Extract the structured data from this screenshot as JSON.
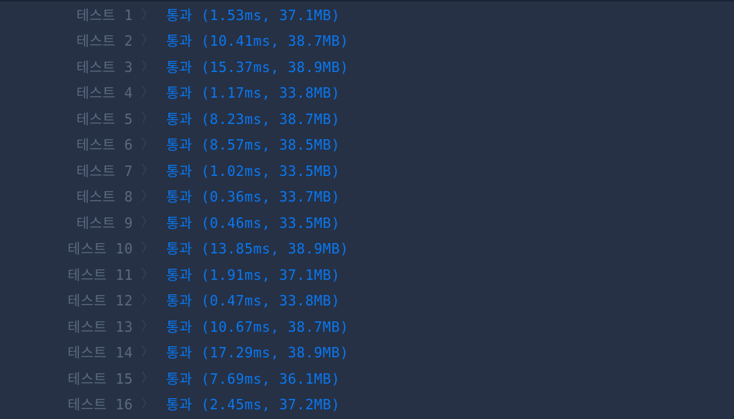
{
  "results": [
    {
      "label": "테스트 1",
      "chevron": "〉",
      "status": "통과",
      "detail": "(1.53ms, 37.1MB)"
    },
    {
      "label": "테스트 2",
      "chevron": "〉",
      "status": "통과",
      "detail": "(10.41ms, 38.7MB)"
    },
    {
      "label": "테스트 3",
      "chevron": "〉",
      "status": "통과",
      "detail": "(15.37ms, 38.9MB)"
    },
    {
      "label": "테스트 4",
      "chevron": "〉",
      "status": "통과",
      "detail": "(1.17ms, 33.8MB)"
    },
    {
      "label": "테스트 5",
      "chevron": "〉",
      "status": "통과",
      "detail": "(8.23ms, 38.7MB)"
    },
    {
      "label": "테스트 6",
      "chevron": "〉",
      "status": "통과",
      "detail": "(8.57ms, 38.5MB)"
    },
    {
      "label": "테스트 7",
      "chevron": "〉",
      "status": "통과",
      "detail": "(1.02ms, 33.5MB)"
    },
    {
      "label": "테스트 8",
      "chevron": "〉",
      "status": "통과",
      "detail": "(0.36ms, 33.7MB)"
    },
    {
      "label": "테스트 9",
      "chevron": "〉",
      "status": "통과",
      "detail": "(0.46ms, 33.5MB)"
    },
    {
      "label": "테스트 10",
      "chevron": "〉",
      "status": "통과",
      "detail": "(13.85ms, 38.9MB)"
    },
    {
      "label": "테스트 11",
      "chevron": "〉",
      "status": "통과",
      "detail": "(1.91ms, 37.1MB)"
    },
    {
      "label": "테스트 12",
      "chevron": "〉",
      "status": "통과",
      "detail": "(0.47ms, 33.8MB)"
    },
    {
      "label": "테스트 13",
      "chevron": "〉",
      "status": "통과",
      "detail": "(10.67ms, 38.7MB)"
    },
    {
      "label": "테스트 14",
      "chevron": "〉",
      "status": "통과",
      "detail": "(17.29ms, 38.9MB)"
    },
    {
      "label": "테스트 15",
      "chevron": "〉",
      "status": "통과",
      "detail": "(7.69ms, 36.1MB)"
    },
    {
      "label": "테스트 16",
      "chevron": "〉",
      "status": "통과",
      "detail": "(2.45ms, 37.2MB)"
    }
  ],
  "colors": {
    "background": "#263146",
    "label": "#5a6a80",
    "pass": "#0a78f0",
    "chevron": "#36435a"
  }
}
